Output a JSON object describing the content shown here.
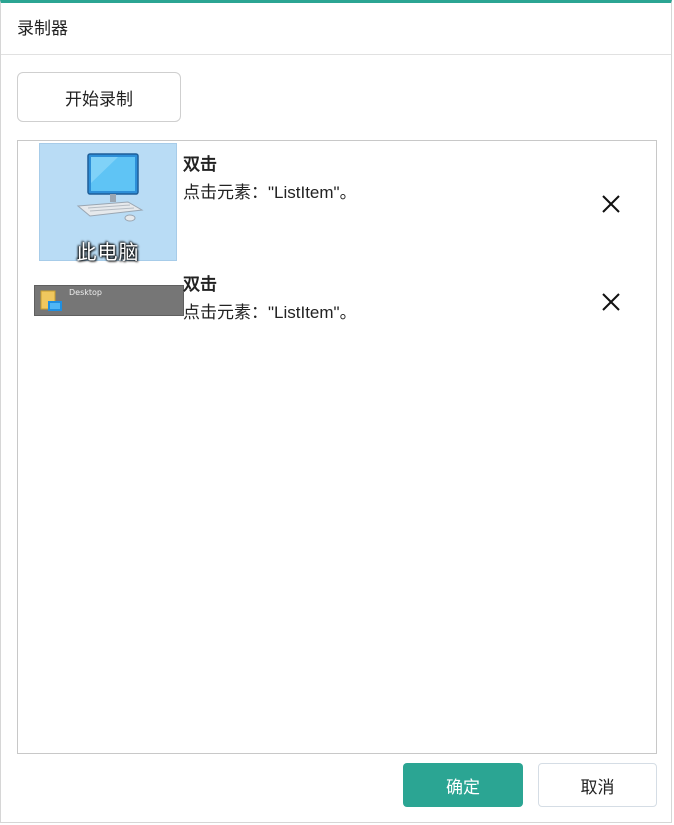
{
  "window": {
    "title": "录制器"
  },
  "toolbar": {
    "start_label": "开始录制"
  },
  "steps": [
    {
      "action": "双击",
      "description": "点击元素：\"ListItem\"。",
      "thumbnail_text": "此电脑",
      "thumbnail_icon": "computer-icon"
    },
    {
      "action": "双击",
      "description": "点击元素：\"ListItem\"。",
      "thumbnail_text": "Desktop",
      "thumbnail_icon": "folder-icon"
    }
  ],
  "footer": {
    "ok_label": "确定",
    "cancel_label": "取消"
  },
  "colors": {
    "accent": "#2ba593",
    "thumb1_bg": "#b9dcf5",
    "thumb2_bg": "#767676"
  }
}
